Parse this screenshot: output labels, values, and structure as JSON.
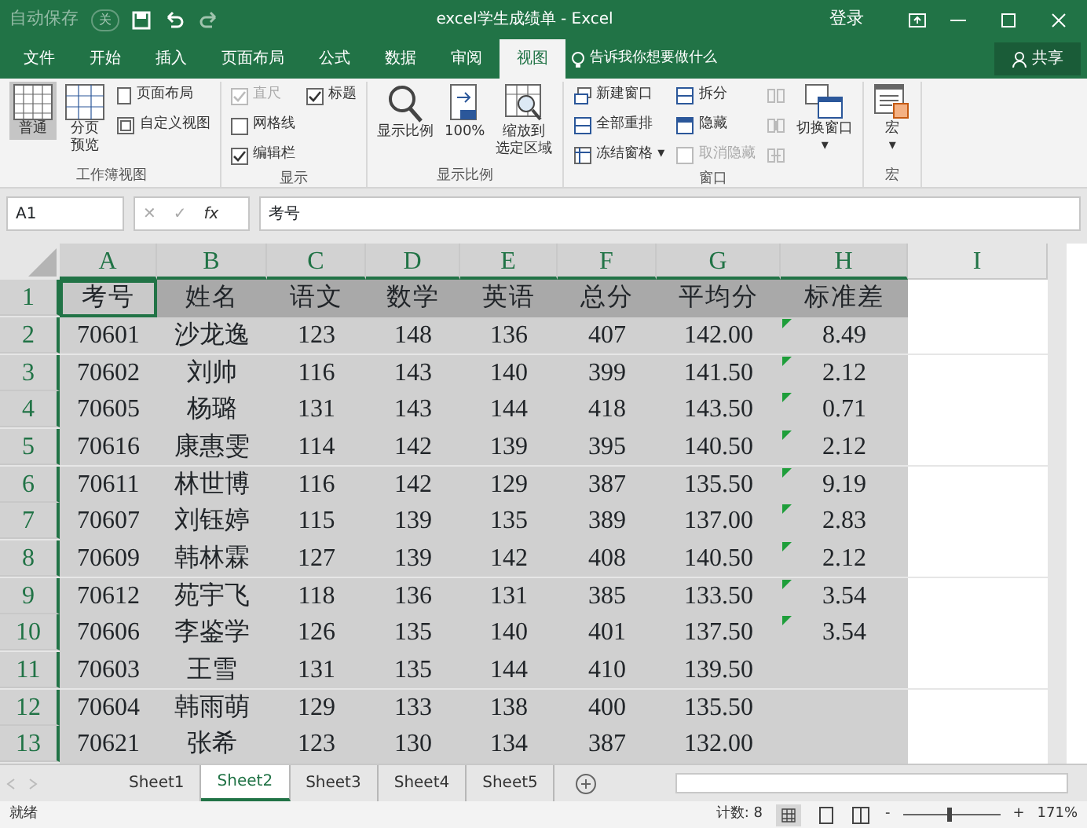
{
  "title_bar": {
    "autosave_label": "自动保存",
    "autosave_toggle": "关",
    "autosave_on": false,
    "title": "excel学生成绩单  -  Excel",
    "login": "登录"
  },
  "tabs": [
    {
      "label": "文件",
      "selected": false
    },
    {
      "label": "开始",
      "selected": false
    },
    {
      "label": "插入",
      "selected": false
    },
    {
      "label": "页面布局",
      "selected": false
    },
    {
      "label": "公式",
      "selected": false
    },
    {
      "label": "数据",
      "selected": false
    },
    {
      "label": "审阅",
      "selected": false
    },
    {
      "label": "视图",
      "selected": true
    }
  ],
  "tell_me": "告诉我你想要做什么",
  "share": "共享",
  "ribbon": [
    {
      "label": "工作簿视图",
      "items": [
        {
          "kind": "big",
          "lines": [
            "普通"
          ],
          "selected": true
        },
        {
          "kind": "big",
          "lines": [
            "分页",
            "预览"
          ],
          "selected": false
        },
        {
          "kind": "small",
          "label": "页面布局",
          "disabled": false
        },
        {
          "kind": "small",
          "label": "自定义视图",
          "disabled": false
        }
      ]
    },
    {
      "label": "显示",
      "items": [
        {
          "kind": "check",
          "label": "直尺",
          "checked": true,
          "disabled": true
        },
        {
          "kind": "check",
          "label": "网格线",
          "checked": false,
          "disabled": false
        },
        {
          "kind": "check",
          "label": "编辑栏",
          "checked": true,
          "disabled": false
        },
        {
          "kind": "check",
          "label": "标题",
          "checked": true,
          "disabled": false
        }
      ]
    },
    {
      "label": "显示比例",
      "items": [
        {
          "kind": "big",
          "lines": [
            "显示比例"
          ],
          "selected": false
        },
        {
          "kind": "big",
          "lines": [
            "100%"
          ],
          "selected": false
        },
        {
          "kind": "big",
          "lines": [
            "缩放到",
            "选定区域"
          ],
          "selected": false
        }
      ]
    },
    {
      "label": "窗口",
      "items": [
        {
          "kind": "small",
          "label": "新建窗口",
          "disabled": false
        },
        {
          "kind": "small",
          "label": "全部重排",
          "disabled": false
        },
        {
          "kind": "small",
          "label": "冻结窗格 ▾",
          "disabled": false
        },
        {
          "kind": "small",
          "label": "拆分",
          "disabled": false
        },
        {
          "kind": "small",
          "label": "隐藏",
          "disabled": false
        },
        {
          "kind": "small",
          "label": "取消隐藏",
          "disabled": true
        },
        {
          "kind": "iconbtn",
          "disabled": true
        },
        {
          "kind": "iconbtn",
          "disabled": true
        },
        {
          "kind": "iconbtn",
          "disabled": true
        },
        {
          "kind": "big",
          "lines": [
            "切换窗口",
            "▾"
          ],
          "selected": false
        }
      ]
    },
    {
      "label": "宏",
      "items": [
        {
          "kind": "big",
          "lines": [
            "宏",
            "▾"
          ],
          "selected": false
        }
      ]
    }
  ],
  "formula_bar": {
    "name_box": "A1",
    "cancel": "✕",
    "enter": "✓",
    "fx": "fx",
    "value": "考号"
  },
  "columns": [
    {
      "label": "A",
      "selected": true,
      "active": true
    },
    {
      "label": "B",
      "selected": true
    },
    {
      "label": "C",
      "selected": true
    },
    {
      "label": "D",
      "selected": true
    },
    {
      "label": "E",
      "selected": true
    },
    {
      "label": "F",
      "selected": true
    },
    {
      "label": "G",
      "selected": true
    },
    {
      "label": "H",
      "selected": true
    },
    {
      "label": "I",
      "selected": false
    }
  ],
  "rows": [
    {
      "label": "1",
      "selected": true,
      "active": true,
      "kind": "header",
      "cells": [
        "考号",
        "姓名",
        "语文",
        "数学",
        "英语",
        "总分",
        "平均分",
        "标准差"
      ],
      "flag": false
    },
    {
      "label": "2",
      "selected": true,
      "kind": "data",
      "cells": [
        "70601",
        "沙龙逸",
        "123",
        "148",
        "136",
        "407",
        "142.00",
        "8.49"
      ],
      "flag": true
    },
    {
      "label": "3",
      "selected": true,
      "kind": "data",
      "cells": [
        "70602",
        "刘帅",
        "116",
        "143",
        "140",
        "399",
        "141.50",
        "2.12"
      ],
      "flag": true
    },
    {
      "label": "4",
      "selected": true,
      "kind": "data",
      "cells": [
        "70605",
        "杨璐",
        "131",
        "143",
        "144",
        "418",
        "143.50",
        "0.71"
      ],
      "flag": true
    },
    {
      "label": "5",
      "selected": true,
      "kind": "data",
      "cells": [
        "70616",
        "康惠雯",
        "114",
        "142",
        "139",
        "395",
        "140.50",
        "2.12"
      ],
      "flag": true
    },
    {
      "label": "6",
      "selected": true,
      "kind": "data",
      "cells": [
        "70611",
        "林世博",
        "116",
        "142",
        "129",
        "387",
        "135.50",
        "9.19"
      ],
      "flag": true
    },
    {
      "label": "7",
      "selected": true,
      "kind": "data",
      "cells": [
        "70607",
        "刘钰婷",
        "115",
        "139",
        "135",
        "389",
        "137.00",
        "2.83"
      ],
      "flag": true
    },
    {
      "label": "8",
      "selected": true,
      "kind": "data",
      "cells": [
        "70609",
        "韩林霖",
        "127",
        "139",
        "142",
        "408",
        "140.50",
        "2.12"
      ],
      "flag": true
    },
    {
      "label": "9",
      "selected": true,
      "kind": "data",
      "cells": [
        "70612",
        "苑宇飞",
        "118",
        "136",
        "131",
        "385",
        "133.50",
        "3.54"
      ],
      "flag": true
    },
    {
      "label": "10",
      "selected": true,
      "kind": "data",
      "cells": [
        "70606",
        "李鉴学",
        "126",
        "135",
        "140",
        "401",
        "137.50",
        "3.54"
      ],
      "flag": true
    },
    {
      "label": "11",
      "selected": true,
      "kind": "data",
      "cells": [
        "70603",
        "王雪",
        "131",
        "135",
        "144",
        "410",
        "139.50"
      ],
      "flag": false
    },
    {
      "label": "12",
      "selected": true,
      "kind": "data",
      "cells": [
        "70604",
        "韩雨萌",
        "129",
        "133",
        "138",
        "400",
        "135.50"
      ],
      "flag": false
    },
    {
      "label": "13",
      "selected": true,
      "kind": "data",
      "cells": [
        "70621",
        "张希",
        "123",
        "130",
        "134",
        "387",
        "132.00"
      ],
      "flag": false
    }
  ],
  "sheets": [
    {
      "label": "Sheet1",
      "selected": false
    },
    {
      "label": "Sheet2",
      "selected": true
    },
    {
      "label": "Sheet3",
      "selected": false
    },
    {
      "label": "Sheet4",
      "selected": false
    },
    {
      "label": "Sheet5",
      "selected": false
    }
  ],
  "status_bar": {
    "ready": "就绪",
    "count": "计数: 8",
    "zoom": "171%",
    "zoom_minus": "-",
    "zoom_plus": "+",
    "zoom_slider": {
      "level": 0.45
    }
  }
}
